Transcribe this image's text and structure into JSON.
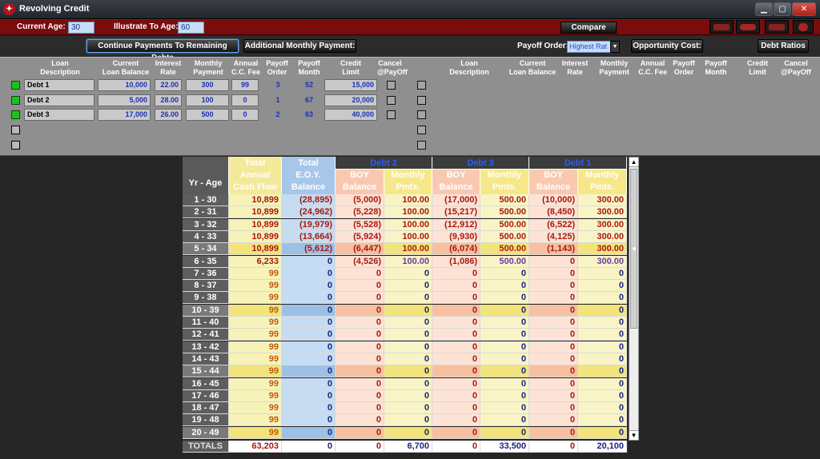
{
  "window": {
    "title": "Revolving Credit"
  },
  "header": {
    "current_age_label": "Current Age:",
    "current_age_value": "30",
    "illustrate_label": "Illustrate To Age:",
    "illustrate_value": "60",
    "compare_label": "Compare"
  },
  "toolbar": {
    "continue_label": "Continue Payments To Remaining Debts",
    "additional_label": "Additional Monthly Payment:",
    "payoff_order_label": "Payoff Order:",
    "payoff_order_value": "Highest Rat",
    "opportunity_label": "Opportunity Cost:",
    "debt_ratios_label": "Debt Ratios"
  },
  "panel": {
    "headers": [
      "Loan\nDescription",
      "Current\nLoan Balance",
      "Interest\nRate",
      "Monthly\nPayment",
      "Annual\nC.C. Fee",
      "Payoff\nOrder",
      "Payoff\nMonth",
      "Credit\nLimit",
      "Cancel\n@PayOff"
    ],
    "left_rows": [
      {
        "active": true,
        "desc": "Debt 1",
        "balance": "10,000",
        "rate": "22.00",
        "payment": "300",
        "fee": "99",
        "order": "3",
        "month": "52",
        "limit": "15,000"
      },
      {
        "active": true,
        "desc": "Debt 2",
        "balance": "5,000",
        "rate": "28.00",
        "payment": "100",
        "fee": "0",
        "order": "1",
        "month": "67",
        "limit": "20,000"
      },
      {
        "active": true,
        "desc": "Debt 3",
        "balance": "17,000",
        "rate": "26.00",
        "payment": "500",
        "fee": "0",
        "order": "2",
        "month": "63",
        "limit": "40,000"
      }
    ]
  },
  "grid": {
    "yr_age_label": "Yr - Age",
    "total_cash_label": "Total\nAnnual\nCash Flow",
    "total_eoy_label": "Total\nE.O.Y.\nBalance",
    "debt_groups": [
      "Debt 2",
      "Debt 3",
      "Debt 1"
    ],
    "boy_label": "BOY\nBalance",
    "monthly_label": "Monthly\nPmts.",
    "rows": [
      [
        "1 - 30",
        "10,899",
        "(28,895)",
        "(5,000)",
        "100.00",
        "(17,000)",
        "500.00",
        "(10,000)",
        "300.00"
      ],
      [
        "2 - 31",
        "10,899",
        "(24,962)",
        "(5,228)",
        "100.00",
        "(15,217)",
        "500.00",
        "(8,450)",
        "300.00"
      ],
      [
        "3 - 32",
        "10,899",
        "(19,979)",
        "(5,528)",
        "100.00",
        "(12,912)",
        "500.00",
        "(6,522)",
        "300.00"
      ],
      [
        "4 - 33",
        "10,899",
        "(13,664)",
        "(5,924)",
        "100.00",
        "(9,930)",
        "500.00",
        "(4,125)",
        "300.00"
      ],
      [
        "5 - 34",
        "10,899",
        "(5,612)",
        "(6,447)",
        "100.00",
        "(6,074)",
        "500.00",
        "(1,143)",
        "300.00"
      ],
      [
        "6 - 35",
        "6,233",
        "0",
        "(4,526)",
        "100.00",
        "(1,086)",
        "500.00",
        "0",
        "300.00"
      ],
      [
        "7 - 36",
        "99",
        "0",
        "0",
        "0",
        "0",
        "0",
        "0",
        "0"
      ],
      [
        "8 - 37",
        "99",
        "0",
        "0",
        "0",
        "0",
        "0",
        "0",
        "0"
      ],
      [
        "9 - 38",
        "99",
        "0",
        "0",
        "0",
        "0",
        "0",
        "0",
        "0"
      ],
      [
        "10 - 39",
        "99",
        "0",
        "0",
        "0",
        "0",
        "0",
        "0",
        "0"
      ],
      [
        "11 - 40",
        "99",
        "0",
        "0",
        "0",
        "0",
        "0",
        "0",
        "0"
      ],
      [
        "12 - 41",
        "99",
        "0",
        "0",
        "0",
        "0",
        "0",
        "0",
        "0"
      ],
      [
        "13 - 42",
        "99",
        "0",
        "0",
        "0",
        "0",
        "0",
        "0",
        "0"
      ],
      [
        "14 - 43",
        "99",
        "0",
        "0",
        "0",
        "0",
        "0",
        "0",
        "0"
      ],
      [
        "15 - 44",
        "99",
        "0",
        "0",
        "0",
        "0",
        "0",
        "0",
        "0"
      ],
      [
        "16 - 45",
        "99",
        "0",
        "0",
        "0",
        "0",
        "0",
        "0",
        "0"
      ],
      [
        "17 - 46",
        "99",
        "0",
        "0",
        "0",
        "0",
        "0",
        "0",
        "0"
      ],
      [
        "18 - 47",
        "99",
        "0",
        "0",
        "0",
        "0",
        "0",
        "0",
        "0"
      ],
      [
        "19 - 48",
        "99",
        "0",
        "0",
        "0",
        "0",
        "0",
        "0",
        "0"
      ],
      [
        "20 - 49",
        "99",
        "0",
        "0",
        "0",
        "0",
        "0",
        "0",
        "0"
      ]
    ],
    "totals": [
      "TOTALS",
      "63,203",
      "0",
      "0",
      "6,700",
      "0",
      "33,500",
      "0",
      "20,100"
    ]
  },
  "colors": {
    "title_red": "#7a0c0c",
    "cash_flow_col": "#f7f2b8",
    "eoy_col": "#c5dcf2",
    "boy_col": "#fde3d6",
    "monthly_col": "#f9f4c6",
    "negative_text": "#a8190f",
    "blue_text": "#1a2fb8"
  }
}
